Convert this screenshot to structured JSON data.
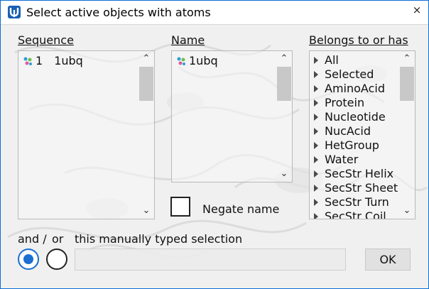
{
  "window": {
    "title": "Select active objects with atoms",
    "close_glyph": "×"
  },
  "sequence": {
    "label": "Sequence",
    "items": [
      {
        "index": "1",
        "name": "1ubq"
      }
    ]
  },
  "name_panel": {
    "label": "Name",
    "items": [
      {
        "name": "1ubq"
      }
    ]
  },
  "belongs": {
    "label": "Belongs to or has",
    "items": [
      "All",
      "Selected",
      "AminoAcid",
      "Protein",
      "Nucleotide",
      "NucAcid",
      "HetGroup",
      "Water",
      "SecStr Helix",
      "SecStr Sheet",
      "SecStr Turn",
      "SecStr Coil"
    ]
  },
  "negate": {
    "label": "Negate name",
    "checked": false
  },
  "combine": {
    "and_label": "and /",
    "or_label": "or",
    "text": "this manually typed selection",
    "selected": "and"
  },
  "selection_input": {
    "value": ""
  },
  "ok_button": {
    "label": "OK"
  },
  "colors": {
    "accent": "#1a6fd0",
    "border": "#0b6dd6"
  },
  "icons": {
    "title": "app-logo-icon",
    "molecule": "molecule-icon",
    "expand": "triangle-right-icon"
  }
}
